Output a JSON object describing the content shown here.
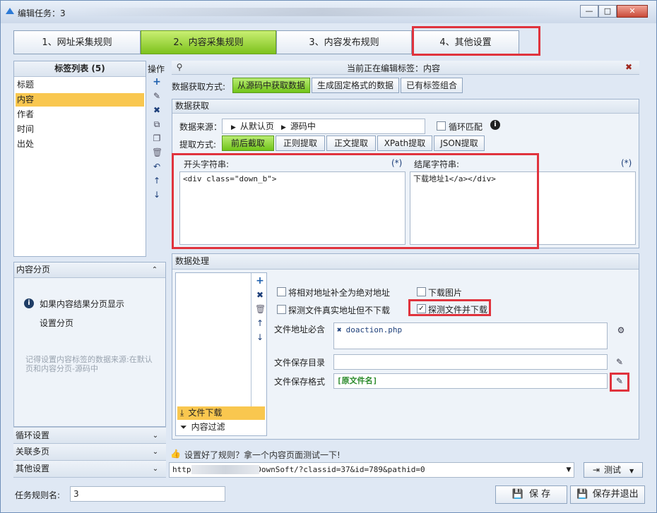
{
  "window": {
    "title": "编辑任务：3",
    "min": "—",
    "max": "□",
    "close": "✕"
  },
  "steps": [
    "1、网址采集规则",
    "2、内容采集规则",
    "3、内容发布规则",
    "4、其他设置"
  ],
  "tags": {
    "title": "标签列表 (5)",
    "items": [
      "标题",
      "内容",
      "作者",
      "时间",
      "出处"
    ]
  },
  "ops": {
    "title": "操作"
  },
  "editing": "当前正在编辑标签：内容",
  "fetch_mode": {
    "label": "数据获取方式:",
    "options": [
      "从源码中获取数据",
      "生成固定格式的数据",
      "已有标签组合"
    ]
  },
  "data_fetch": {
    "title": "数据获取",
    "source_label": "数据来源：",
    "source_parts": [
      "从默认页",
      "源码中"
    ],
    "loop_match": "循环匹配",
    "method_label": "提取方式:",
    "methods": [
      "前后截取",
      "正则提取",
      "正文提取",
      "XPath提取",
      "JSON提取"
    ],
    "start_label": "开头字符串:",
    "end_label": "结尾字符串:",
    "star": "(*)",
    "start_value": "<div class=\"down_b\">",
    "end_value": "下载地址1</a></div>"
  },
  "pagination": {
    "title": "内容分页",
    "hint": "如果内容结果分页显示",
    "link": "设置分页",
    "note": "记得设置内容标签的数据来源:在默认页和内容分页-源码中"
  },
  "side_sections": [
    "循环设置",
    "关联多页",
    "其他设置"
  ],
  "processing": {
    "title": "数据处理",
    "list_items": [
      "文件下载",
      "内容过滤"
    ],
    "cb_relative": "将相对地址补全为绝对地址",
    "cb_download_img": "下载图片",
    "cb_detect_real": "探测文件真实地址但不下载",
    "cb_detect_download": "探测文件并下载",
    "must_contain_label": "文件地址必含",
    "must_contain_value": "doaction.php",
    "save_dir_label": "文件保存目录",
    "save_dir_value": "",
    "save_fmt_label": "文件保存格式",
    "save_fmt_value": "[原文件名]"
  },
  "test": {
    "hint": "设置好了规则？拿一个内容页面测试一下!",
    "url": "https:                      /e/DownSys/DownSoft/?classid=37&id=789&pathid=0",
    "button": "测试"
  },
  "footer": {
    "name_label": "任务规则名:",
    "name_value": "3",
    "save": "保 存",
    "save_exit": "保存并退出"
  },
  "colors": {
    "accent_green": "#7dc21d",
    "highlight": "#f9c74f",
    "red_box": "#e0333d"
  }
}
